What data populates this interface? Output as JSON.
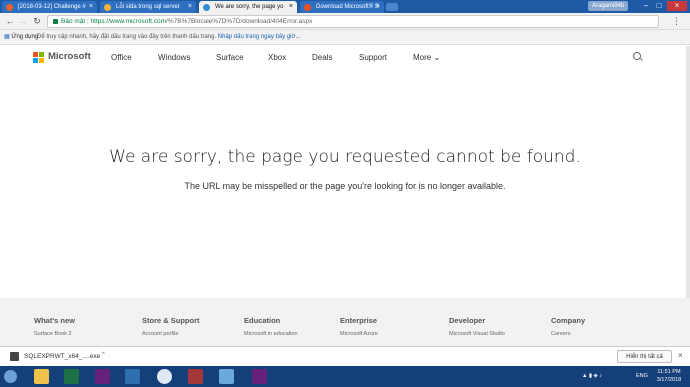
{
  "tabs": [
    {
      "title": "[2018-03-12] Challenge #",
      "icon_color": "#e8612c"
    },
    {
      "title": "Lỗi sida trong sql server",
      "icon_color": "#f1b33d"
    },
    {
      "title": "We are sorry, the page yo",
      "icon_color": "#2f8dd6"
    },
    {
      "title": "Download Microsoft® S",
      "icon_color": "#f25022"
    }
  ],
  "window": {
    "user": "Aragami94b"
  },
  "addressbar": {
    "secure_label": "Bảo mật",
    "url_host": "https://www.microsoft.com",
    "url_path": "/%7B%7Blocale%7D%7D/download/404Error.aspx"
  },
  "bookmarks": {
    "apps_label": "Ứng dụng",
    "hint": "Để truy cập nhanh, hãy đặt dấu trang vào đây trên thanh dấu trang. ",
    "import_link": "Nhập dấu trang ngay bây giờ..."
  },
  "header": {
    "brand": "Microsoft",
    "nav": [
      "Office",
      "Windows",
      "Surface",
      "Xbox",
      "Deals",
      "Support",
      "More"
    ],
    "more_chevron": "⌄"
  },
  "message": {
    "title": "We are sorry, the page you requested cannot be found.",
    "subtitle": "The URL may be misspelled or the page you're looking for is no longer available."
  },
  "footer": {
    "columns": [
      {
        "heading": "What's new",
        "link": "Surface Book 2"
      },
      {
        "heading": "Store & Support",
        "link": "Account profile"
      },
      {
        "heading": "Education",
        "link": "Microsoft in education"
      },
      {
        "heading": "Enterprise",
        "link": "Microsoft Azure"
      },
      {
        "heading": "Developer",
        "link": "Microsoft Visual Studio"
      },
      {
        "heading": "Company",
        "link": "Careers"
      }
    ]
  },
  "download": {
    "filename": "SQLEXPRWT_x64_....exe",
    "show_all": "Hiển thị tất cả"
  },
  "taskbar": {
    "lang": "ENG",
    "time": "11:51 PM",
    "date": "3/17/2018"
  },
  "colors": {
    "tabstrip": "#1f5aa6",
    "taskbar": "#143f78",
    "secure": "#0b8043"
  }
}
